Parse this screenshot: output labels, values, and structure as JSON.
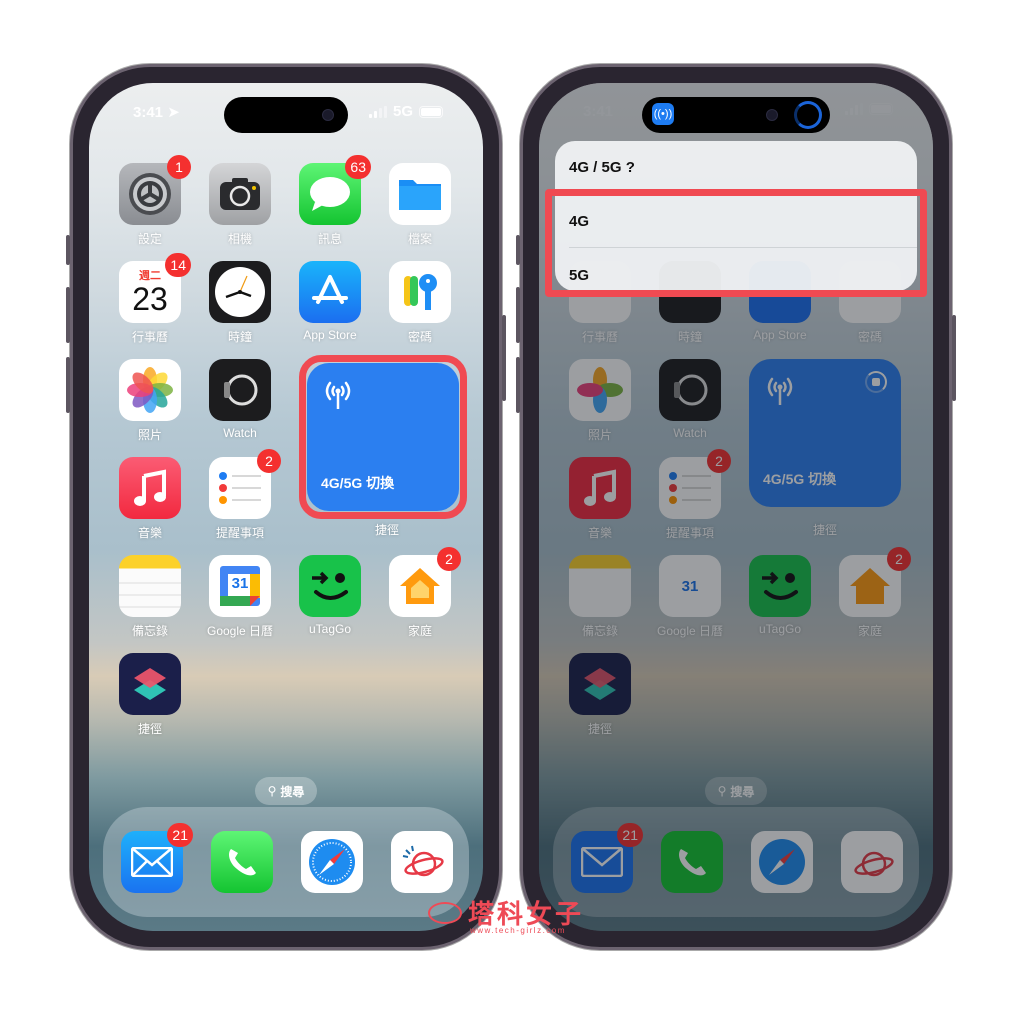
{
  "status_bar": {
    "time": "3:41",
    "network": "5G"
  },
  "home": {
    "apps": [
      {
        "label": "設定",
        "badge": "1",
        "icon": "gear-icon"
      },
      {
        "label": "相機",
        "badge": "",
        "icon": "camera-icon"
      },
      {
        "label": "訊息",
        "badge": "63",
        "icon": "message-bubble-icon"
      },
      {
        "label": "檔案",
        "badge": "",
        "icon": "folder-icon"
      },
      {
        "label": "行事曆",
        "badge": "14",
        "icon": "calendar-icon",
        "weekday": "週二",
        "day": "23"
      },
      {
        "label": "時鐘",
        "badge": "",
        "icon": "clock-icon"
      },
      {
        "label": "App Store",
        "badge": "",
        "icon": "app-store-icon"
      },
      {
        "label": "密碼",
        "badge": "",
        "icon": "keys-icon"
      },
      {
        "label": "照片",
        "badge": "",
        "icon": "photos-flower-icon"
      },
      {
        "label": "Watch",
        "badge": "",
        "icon": "watch-icon"
      },
      {
        "label": "音樂",
        "badge": "",
        "icon": "music-note-icon"
      },
      {
        "label": "提醒事項",
        "badge": "2",
        "icon": "reminders-list-icon"
      },
      {
        "label": "備忘錄",
        "badge": "",
        "icon": "notes-icon"
      },
      {
        "label": "Google 日曆",
        "badge": "",
        "icon": "google-calendar-icon",
        "day": "31"
      },
      {
        "label": "uTagGo",
        "badge": "",
        "icon": "utaggo-face-icon"
      },
      {
        "label": "家庭",
        "badge": "2",
        "icon": "home-house-icon"
      },
      {
        "label": "捷徑",
        "badge": "",
        "icon": "shortcuts-icon"
      }
    ],
    "widget": {
      "title": "4G/5G 切換",
      "app_label": "捷徑",
      "icon": "antenna-icon"
    },
    "search_label": "搜尋",
    "dock": [
      {
        "label": "Mail",
        "badge": "21",
        "icon": "mail-envelope-icon"
      },
      {
        "label": "Phone",
        "badge": "",
        "icon": "phone-handset-icon"
      },
      {
        "label": "Safari",
        "badge": "",
        "icon": "compass-icon"
      },
      {
        "label": "Tech Girlz",
        "badge": "",
        "icon": "planet-logo-icon"
      }
    ]
  },
  "menu": {
    "title": "4G / 5G ?",
    "options": [
      "4G",
      "5G"
    ]
  },
  "watermark": {
    "text": "塔科女子",
    "url": "www.tech-girlz.com"
  },
  "colors": {
    "highlight": "#f04a52",
    "widget": "#2b7ff0",
    "badge": "#f4302f"
  }
}
